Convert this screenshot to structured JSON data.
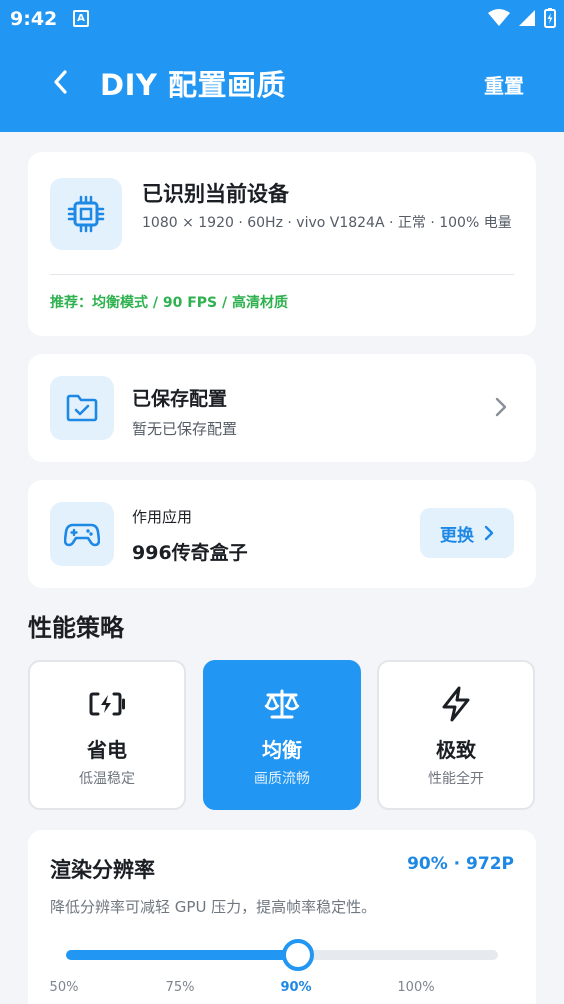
{
  "status_bar": {
    "time": "9:42",
    "notif_letter": "A"
  },
  "appbar": {
    "title": "DIY 配置画质",
    "reset_label": "重置"
  },
  "device": {
    "name": "已识别当前设备",
    "info": "1080 × 1920 · 60Hz · vivo V1824A · 正常 · 100% 电量",
    "recommendation": "推荐：均衡模式 / 90 FPS / 高清材质"
  },
  "saved_config": {
    "title": "已保存配置",
    "subtitle": "暂无已保存配置"
  },
  "target_app": {
    "label": "作用应用",
    "name": "996传奇盒子",
    "change_label": "更换"
  },
  "strategy": {
    "title": "性能策略",
    "modes": [
      {
        "name": "省电",
        "desc": "低温稳定",
        "icon": "battery-charging-icon",
        "active": false
      },
      {
        "name": "均衡",
        "desc": "画质流畅",
        "icon": "balance-scale-icon",
        "active": true
      },
      {
        "name": "极致",
        "desc": "性能全开",
        "icon": "lightning-icon",
        "active": false
      }
    ]
  },
  "resolution": {
    "title": "渲染分辨率",
    "value": "90% · 972P",
    "description": "降低分辨率可减轻 GPU 压力，提高帧率稳定性。",
    "slider_percent": 90,
    "slider_min": 50,
    "slider_max": 100,
    "ticks": [
      "50%",
      "75%",
      "90%",
      "100%"
    ]
  },
  "colors": {
    "primary": "#2196f3",
    "accent_text": "#1e88e5",
    "recommend": "#2fb14f",
    "icon_bg": "#e3f1fd"
  }
}
